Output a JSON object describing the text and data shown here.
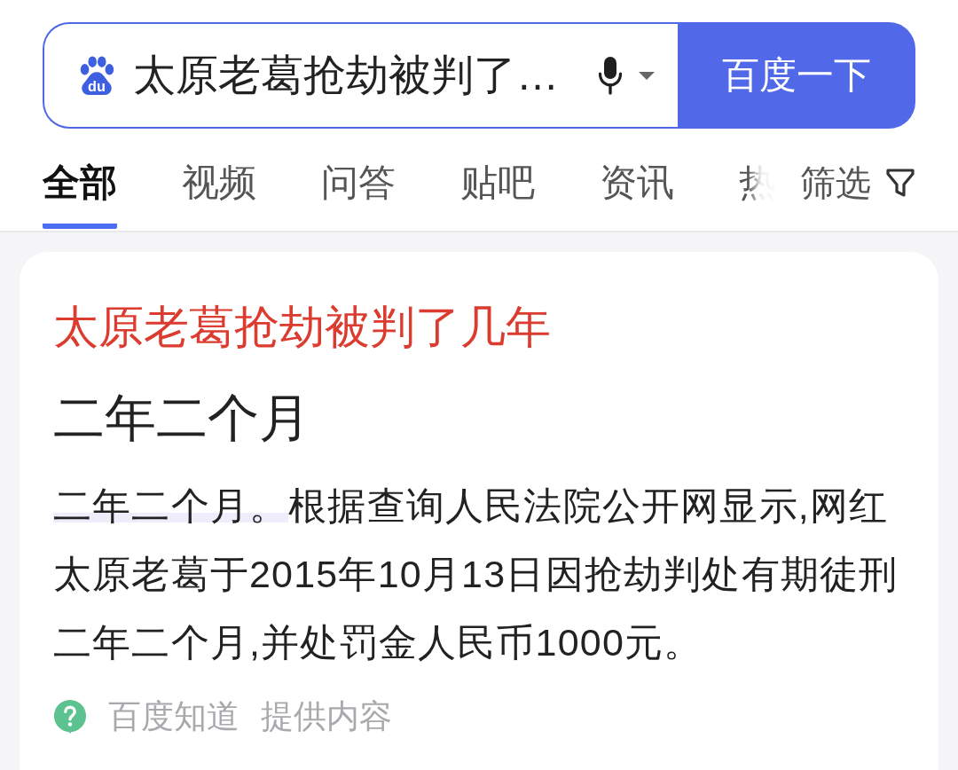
{
  "search": {
    "logo": "du",
    "query": "太原老葛抢劫被判了…",
    "button": "百度一下"
  },
  "tabs": [
    {
      "label": "全部",
      "selected": true
    },
    {
      "label": "视频",
      "selected": false
    },
    {
      "label": "问答",
      "selected": false
    },
    {
      "label": "贴吧",
      "selected": false
    },
    {
      "label": "资讯",
      "selected": false
    },
    {
      "label": "热",
      "selected": false
    }
  ],
  "filter": {
    "label": "筛选"
  },
  "answer": {
    "title": "太原老葛抢劫被判了几年",
    "heading": "二年二个月",
    "highlight": "二年二个月。",
    "text": "根据查询人民法院公开网显示,网红太原老葛于2015年10月13日因抢劫判处有期徒刑二年二个月,并处罚金人民币1000元。",
    "source": "百度知道",
    "source_note": "提供内容"
  }
}
